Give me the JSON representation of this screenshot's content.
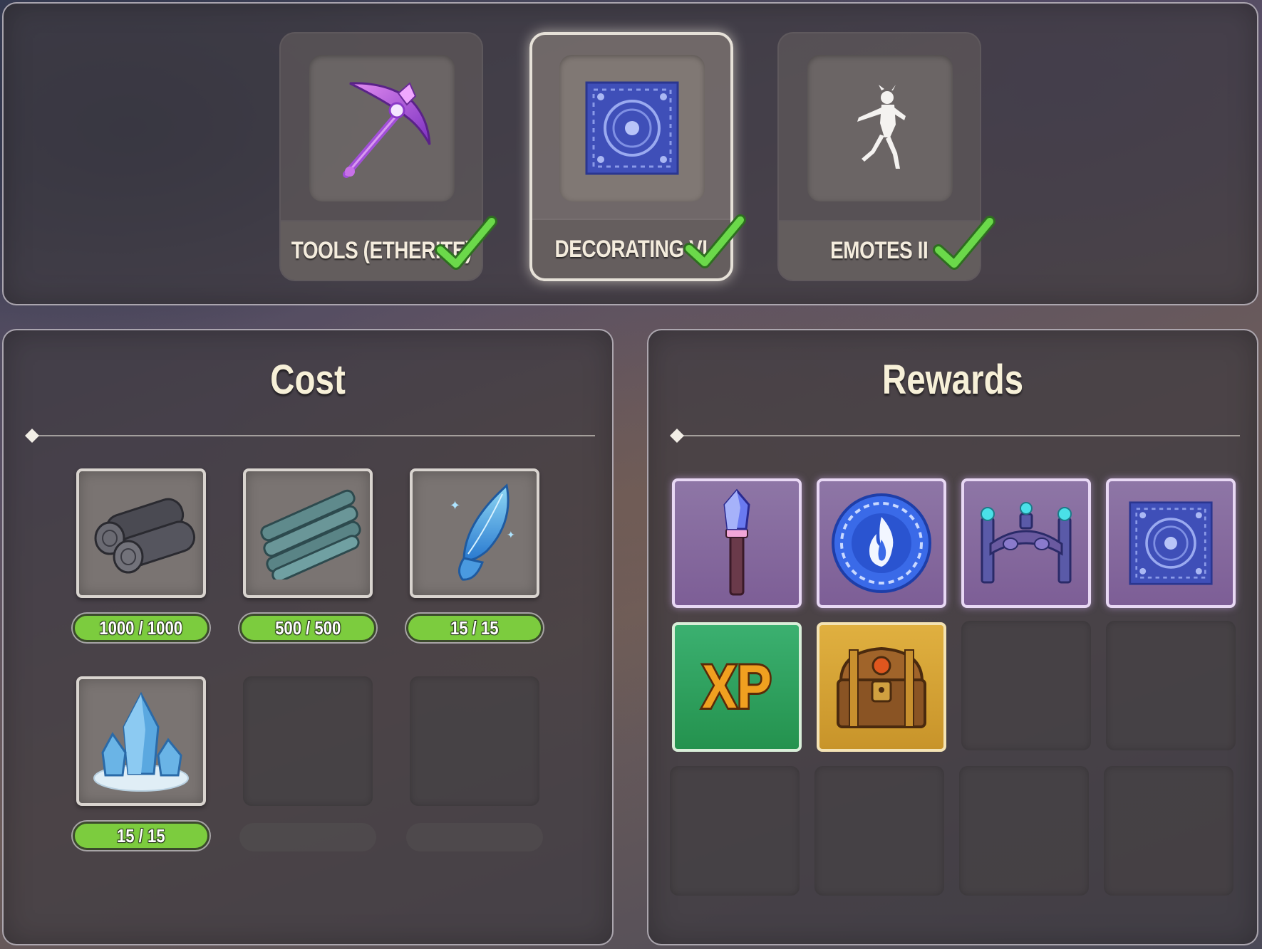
{
  "tabs": [
    {
      "label": "TOOLS (ETHERITE)",
      "icon": "pickaxe-icon",
      "completed": true,
      "selected": false
    },
    {
      "label": "DECORATING VI",
      "icon": "blue-rug-icon",
      "completed": true,
      "selected": true
    },
    {
      "label": "EMOTES II",
      "icon": "dancing-figure-icon",
      "completed": true,
      "selected": false
    }
  ],
  "cost": {
    "title": "Cost",
    "items": [
      {
        "icon": "dark-logs-icon",
        "amount": "1000 / 1000"
      },
      {
        "icon": "teal-planks-icon",
        "amount": "500 / 500"
      },
      {
        "icon": "fairy-wing-icon",
        "amount": "15 / 15"
      },
      {
        "icon": "ice-crystal-icon",
        "amount": "15 / 15"
      }
    ]
  },
  "rewards": {
    "title": "Rewards",
    "items": [
      {
        "icon": "crystal-torch-icon",
        "rarity": "purple"
      },
      {
        "icon": "fire-medallion-icon",
        "rarity": "purple"
      },
      {
        "icon": "crystal-fence-icon",
        "rarity": "purple"
      },
      {
        "icon": "blue-rug-icon",
        "rarity": "purple"
      },
      {
        "icon": "xp-icon",
        "rarity": "green",
        "text": "XP"
      },
      {
        "icon": "treasure-chest-icon",
        "rarity": "gold"
      }
    ]
  },
  "colors": {
    "progress_fill": "#7ccc3e",
    "rare_slot": "#8e76a6",
    "check": "#5ad13c"
  }
}
